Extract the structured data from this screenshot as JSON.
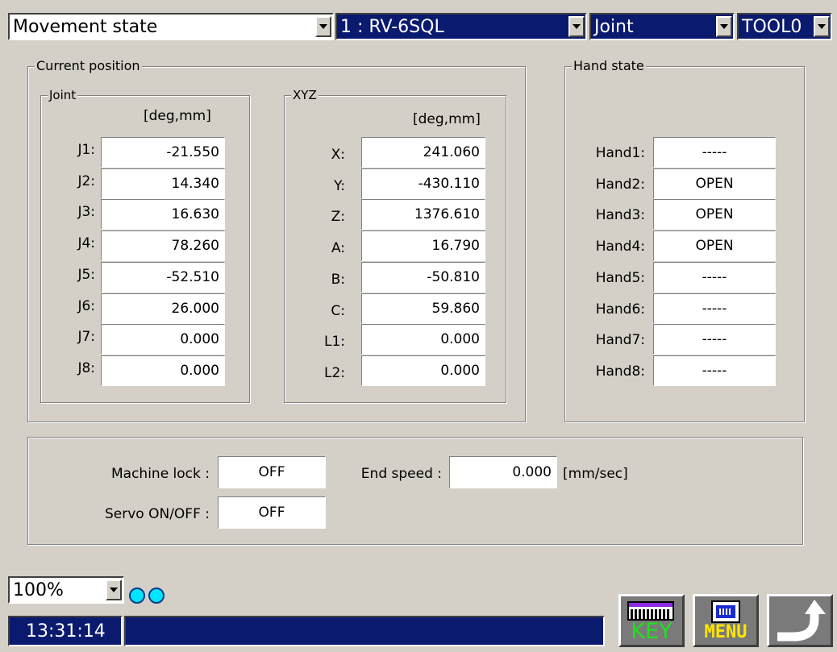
{
  "header": {
    "mode": "Movement state",
    "robot": "1 : RV-6SQL",
    "coord": "Joint",
    "tool": "TOOL0"
  },
  "current_position": {
    "title": "Current position",
    "joint": {
      "title": "Joint",
      "unit": "[deg,mm]",
      "rows": [
        {
          "label": "J1:",
          "value": "-21.550"
        },
        {
          "label": "J2:",
          "value": "14.340"
        },
        {
          "label": "J3:",
          "value": "16.630"
        },
        {
          "label": "J4:",
          "value": "78.260"
        },
        {
          "label": "J5:",
          "value": "-52.510"
        },
        {
          "label": "J6:",
          "value": "26.000"
        },
        {
          "label": "J7:",
          "value": "0.000"
        },
        {
          "label": "J8:",
          "value": "0.000"
        }
      ]
    },
    "xyz": {
      "title": "XYZ",
      "unit": "[deg,mm]",
      "rows": [
        {
          "label": "X:",
          "value": "241.060"
        },
        {
          "label": "Y:",
          "value": "-430.110"
        },
        {
          "label": "Z:",
          "value": "1376.610"
        },
        {
          "label": "A:",
          "value": "16.790"
        },
        {
          "label": "B:",
          "value": "-50.810"
        },
        {
          "label": "C:",
          "value": "59.860"
        },
        {
          "label": "L1:",
          "value": "0.000"
        },
        {
          "label": "L2:",
          "value": "0.000"
        }
      ]
    }
  },
  "hand_state": {
    "title": "Hand state",
    "rows": [
      {
        "label": "Hand1:",
        "value": "-----"
      },
      {
        "label": "Hand2:",
        "value": "OPEN"
      },
      {
        "label": "Hand3:",
        "value": "OPEN"
      },
      {
        "label": "Hand4:",
        "value": "OPEN"
      },
      {
        "label": "Hand5:",
        "value": "-----"
      },
      {
        "label": "Hand6:",
        "value": "-----"
      },
      {
        "label": "Hand7:",
        "value": "-----"
      },
      {
        "label": "Hand8:",
        "value": "-----"
      }
    ]
  },
  "status_panel": {
    "machine_lock_label": "Machine lock :",
    "machine_lock_value": "OFF",
    "servo_label": "Servo ON/OFF :",
    "servo_value": "OFF",
    "end_speed_label": "End speed :",
    "end_speed_value": "0.000",
    "end_speed_unit": "[mm/sec]"
  },
  "footer": {
    "override": "100%",
    "time": "13:31:14",
    "message": "",
    "key_label": "KEY",
    "menu_label": "MENU"
  }
}
